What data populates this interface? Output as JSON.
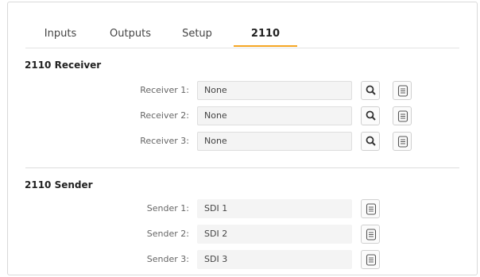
{
  "tabs": [
    {
      "label": "Inputs",
      "active": false
    },
    {
      "label": "Outputs",
      "active": false
    },
    {
      "label": "Setup",
      "active": false
    },
    {
      "label": "2110",
      "active": true
    }
  ],
  "accent_color": "#f5a623",
  "receiver_section": {
    "title": "2110 Receiver",
    "rows": [
      {
        "label": "Receiver 1:",
        "value": "None",
        "buttons": [
          "search-icon",
          "document-icon"
        ]
      },
      {
        "label": "Receiver 2:",
        "value": "None",
        "buttons": [
          "search-icon",
          "document-icon"
        ]
      },
      {
        "label": "Receiver 3:",
        "value": "None",
        "buttons": [
          "search-icon",
          "document-icon"
        ]
      }
    ]
  },
  "sender_section": {
    "title": "2110 Sender",
    "rows": [
      {
        "label": "Sender 1:",
        "value": "SDI 1",
        "buttons": [
          "document-icon"
        ]
      },
      {
        "label": "Sender 2:",
        "value": "SDI 2",
        "buttons": [
          "document-icon"
        ]
      },
      {
        "label": "Sender 3:",
        "value": "SDI 3",
        "buttons": [
          "document-icon"
        ]
      }
    ]
  }
}
